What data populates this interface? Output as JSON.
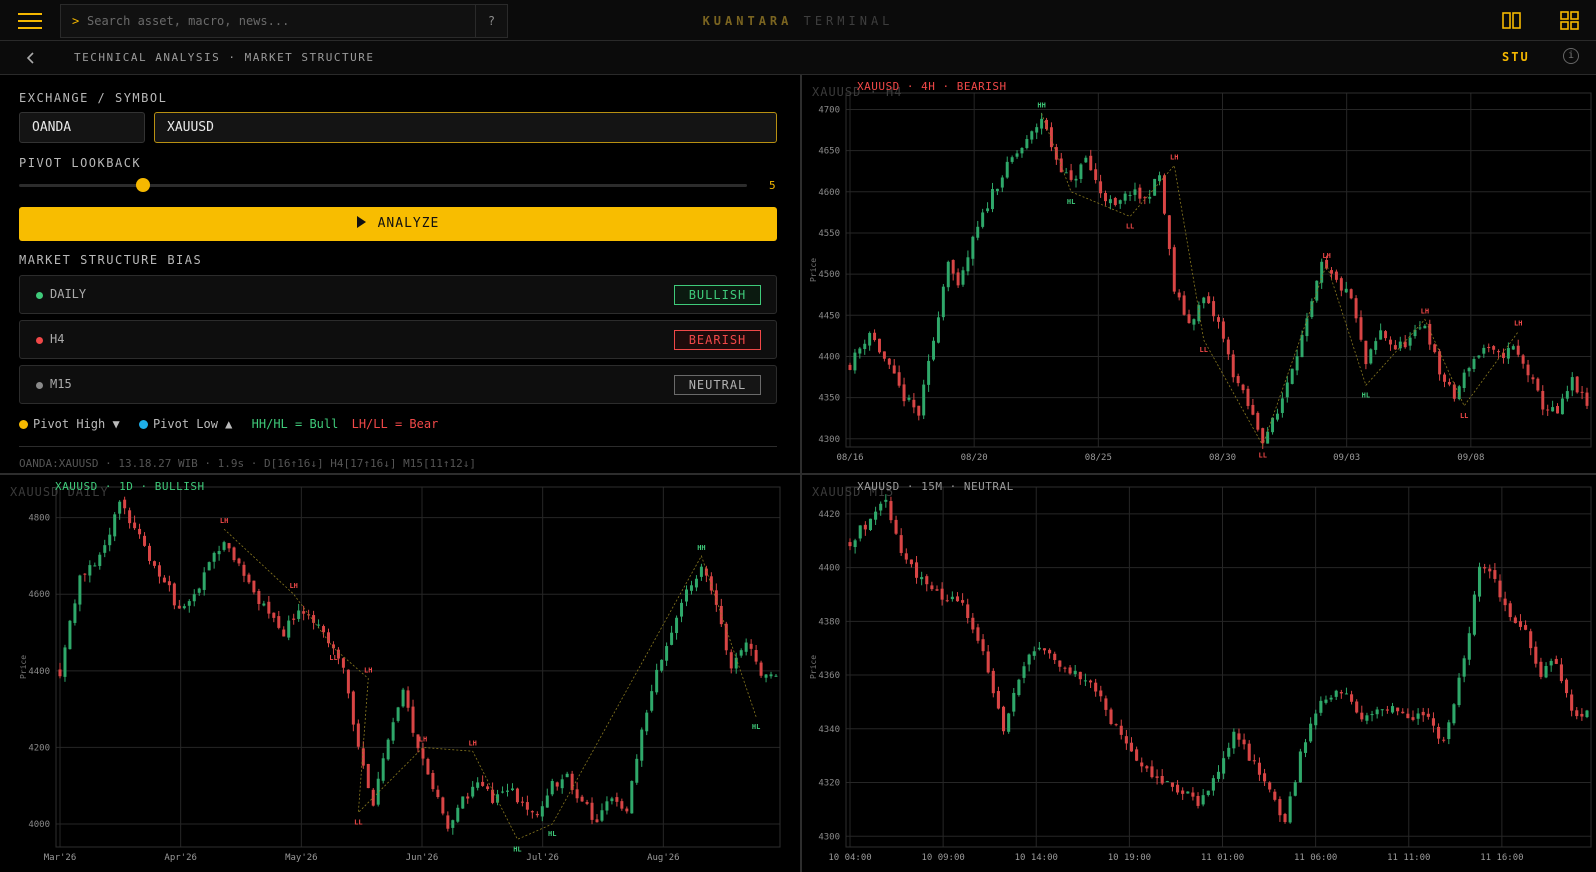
{
  "topbar": {
    "search_placeholder": "Search asset, macro, news...",
    "search_prompt": ">",
    "help_label": "?",
    "brand_primary": "KUANTARA",
    "brand_secondary": "TERMINAL"
  },
  "subbar": {
    "breadcrumb": "TECHNICAL ANALYSIS · MARKET STRUCTURE",
    "user": "STU",
    "info_label": "i"
  },
  "form": {
    "symbol_label": "EXCHANGE / SYMBOL",
    "exchange": "OANDA",
    "symbol": "XAUUSD",
    "pivot_label": "PIVOT LOOKBACK",
    "pivot_value": "5",
    "pivot_fraction": 0.17,
    "analyze_label": "ANALYZE"
  },
  "bias": {
    "title": "MARKET STRUCTURE BIAS",
    "rows": [
      {
        "name": "DAILY",
        "badge": "BULLISH",
        "color": "#3fca7a"
      },
      {
        "name": "H4",
        "badge": "BEARISH",
        "color": "#f04848"
      },
      {
        "name": "M15",
        "badge": "NEUTRAL",
        "color": "#8a8a8a"
      }
    ]
  },
  "legend": {
    "pivot_high": "Pivot High ▼",
    "pivot_low": "Pivot Low ▲",
    "bull": "HH/HL = Bull",
    "bear": "LH/LL = Bear",
    "high_color": "#f5b800",
    "low_color": "#1eaee8"
  },
  "status": "OANDA:XAUUSD · 13.18.27 WIB · 1.9s · D[16↑16↓] H4[17↑16↓] M15[11↑12↓]",
  "colors": {
    "accent": "#f5b800",
    "bull": "#3fca7a",
    "bear": "#f04848",
    "neutral": "#8a8a8a"
  },
  "charts": {
    "h4": {
      "watermark": "XAUUSD · H4",
      "title": "XAUUSD  ·  4H  ·  BEARISH",
      "bias_color": "#f04848",
      "ylabel": "Price",
      "x_ticks": [
        "08/16",
        "08/20",
        "08/25",
        "08/30",
        "09/03",
        "09/08"
      ],
      "y_ticks": [
        "4700",
        "4650",
        "4600",
        "4550",
        "4500",
        "4450",
        "4400",
        "4350",
        "4300"
      ]
    },
    "daily": {
      "watermark": "XAUUSD DAILY",
      "title": "XAUUSD  ·  1D  ·  BULLISH",
      "bias_color": "#3fca7a",
      "ylabel": "Price",
      "x_ticks": [
        "Mar'26",
        "Apr'26",
        "May'26",
        "Jun'26",
        "Jul'26",
        "Aug'26"
      ],
      "y_ticks": [
        "4800",
        "4600",
        "4400",
        "4200",
        "4000"
      ]
    },
    "m15": {
      "watermark": "XAUUSD M15",
      "title": "XAUUSD  ·  15M  ·  NEUTRAL",
      "bias_color": "#9a9a9a",
      "ylabel": "Price",
      "x_ticks": [
        "10 04:00",
        "10 09:00",
        "10 14:00",
        "10 19:00",
        "11 01:00",
        "11 06:00",
        "11 11:00",
        "11 16:00"
      ],
      "y_ticks": [
        "4420",
        "4400",
        "4380",
        "4360",
        "4340",
        "4320",
        "4300"
      ]
    }
  },
  "chart_data": [
    {
      "type": "candlestick",
      "title": "XAUUSD · 4H · BEARISH",
      "ylabel": "Price",
      "ylim": [
        4290,
        4720
      ],
      "x_ticks": [
        "08/16",
        "08/20",
        "08/25",
        "08/30",
        "09/03",
        "09/08"
      ],
      "close_path": [
        [
          0,
          4390
        ],
        [
          4,
          4430
        ],
        [
          8,
          4385
        ],
        [
          11,
          4350
        ],
        [
          14,
          4330
        ],
        [
          17,
          4420
        ],
        [
          20,
          4520
        ],
        [
          22,
          4480
        ],
        [
          25,
          4540
        ],
        [
          29,
          4600
        ],
        [
          33,
          4640
        ],
        [
          36,
          4660
        ],
        [
          39,
          4690
        ],
        [
          42,
          4640
        ],
        [
          45,
          4610
        ],
        [
          48,
          4640
        ],
        [
          51,
          4600
        ],
        [
          54,
          4580
        ],
        [
          57,
          4600
        ],
        [
          60,
          4590
        ],
        [
          63,
          4620
        ],
        [
          66,
          4480
        ],
        [
          69,
          4440
        ],
        [
          72,
          4470
        ],
        [
          75,
          4440
        ],
        [
          78,
          4380
        ],
        [
          81,
          4340
        ],
        [
          84,
          4300
        ],
        [
          87,
          4330
        ],
        [
          90,
          4390
        ],
        [
          93,
          4440
        ],
        [
          96,
          4510
        ],
        [
          99,
          4490
        ],
        [
          102,
          4470
        ],
        [
          105,
          4390
        ],
        [
          108,
          4430
        ],
        [
          111,
          4410
        ],
        [
          114,
          4420
        ],
        [
          117,
          4440
        ],
        [
          120,
          4380
        ],
        [
          123,
          4350
        ],
        [
          126,
          4390
        ],
        [
          129,
          4410
        ],
        [
          132,
          4400
        ],
        [
          135,
          4410
        ],
        [
          138,
          4380
        ],
        [
          141,
          4340
        ],
        [
          144,
          4330
        ],
        [
          147,
          4370
        ],
        [
          150,
          4340
        ]
      ],
      "pivots": [
        {
          "label": "HH",
          "i": 39,
          "price": 4695
        },
        {
          "label": "HL",
          "i": 45,
          "price": 4600
        },
        {
          "label": "LL",
          "i": 57,
          "price": 4570
        },
        {
          "label": "LH",
          "i": 66,
          "price": 4632
        },
        {
          "label": "LL",
          "i": 72,
          "price": 4420
        },
        {
          "label": "LL",
          "i": 84,
          "price": 4292
        },
        {
          "label": "LH",
          "i": 97,
          "price": 4512
        },
        {
          "label": "HL",
          "i": 105,
          "price": 4365
        },
        {
          "label": "LH",
          "i": 117,
          "price": 4445
        },
        {
          "label": "LL",
          "i": 125,
          "price": 4340
        },
        {
          "label": "LH",
          "i": 136,
          "price": 4430
        }
      ]
    },
    {
      "type": "candlestick",
      "title": "XAUUSD · 1D · BULLISH",
      "ylabel": "Price",
      "ylim": [
        3940,
        4880
      ],
      "x_ticks": [
        "Mar'26",
        "Apr'26",
        "May'26",
        "Jun'26",
        "Jul'26",
        "Aug'26"
      ],
      "close_path": [
        [
          0,
          4400
        ],
        [
          4,
          4650
        ],
        [
          8,
          4700
        ],
        [
          12,
          4830
        ],
        [
          15,
          4780
        ],
        [
          18,
          4700
        ],
        [
          21,
          4640
        ],
        [
          24,
          4550
        ],
        [
          27,
          4600
        ],
        [
          30,
          4680
        ],
        [
          33,
          4740
        ],
        [
          36,
          4680
        ],
        [
          39,
          4600
        ],
        [
          42,
          4550
        ],
        [
          45,
          4500
        ],
        [
          48,
          4560
        ],
        [
          51,
          4520
        ],
        [
          54,
          4480
        ],
        [
          57,
          4400
        ],
        [
          60,
          4200
        ],
        [
          63,
          4050
        ],
        [
          66,
          4230
        ],
        [
          69,
          4350
        ],
        [
          72,
          4200
        ],
        [
          75,
          4100
        ],
        [
          78,
          4000
        ],
        [
          81,
          4060
        ],
        [
          84,
          4120
        ],
        [
          87,
          4060
        ],
        [
          90,
          4100
        ],
        [
          93,
          4050
        ],
        [
          96,
          4010
        ],
        [
          99,
          4100
        ],
        [
          102,
          4120
        ],
        [
          105,
          4060
        ],
        [
          108,
          4000
        ],
        [
          111,
          4080
        ],
        [
          114,
          4040
        ],
        [
          117,
          4250
        ],
        [
          120,
          4400
        ],
        [
          123,
          4500
        ],
        [
          126,
          4600
        ],
        [
          129,
          4680
        ],
        [
          132,
          4560
        ],
        [
          135,
          4420
        ],
        [
          138,
          4480
        ],
        [
          141,
          4400
        ],
        [
          144,
          4380
        ]
      ],
      "pivots": [
        {
          "label": "LH",
          "i": 33,
          "price": 4770
        },
        {
          "label": "LH",
          "i": 47,
          "price": 4600
        },
        {
          "label": "LL",
          "i": 55,
          "price": 4460
        },
        {
          "label": "LH",
          "i": 62,
          "price": 4380
        },
        {
          "label": "LL",
          "i": 60,
          "price": 4030
        },
        {
          "label": "LH",
          "i": 73,
          "price": 4200
        },
        {
          "label": "LH",
          "i": 83,
          "price": 4190
        },
        {
          "label": "HL",
          "i": 92,
          "price": 3960
        },
        {
          "label": "HL",
          "i": 99,
          "price": 4000
        },
        {
          "label": "HH",
          "i": 129,
          "price": 4700
        },
        {
          "label": "HL",
          "i": 140,
          "price": 4280
        }
      ]
    },
    {
      "type": "candlestick",
      "title": "XAUUSD · 15M · NEUTRAL",
      "ylabel": "Price",
      "ylim": [
        4296,
        4430
      ],
      "x_ticks": [
        "10 04:00",
        "10 09:00",
        "10 14:00",
        "10 19:00",
        "11 01:00",
        "11 06:00",
        "11 11:00",
        "11 16:00"
      ],
      "close_path": [
        [
          0,
          4410
        ],
        [
          4,
          4418
        ],
        [
          7,
          4425
        ],
        [
          10,
          4405
        ],
        [
          14,
          4395
        ],
        [
          18,
          4390
        ],
        [
          22,
          4385
        ],
        [
          26,
          4370
        ],
        [
          30,
          4340
        ],
        [
          33,
          4360
        ],
        [
          36,
          4370
        ],
        [
          40,
          4365
        ],
        [
          44,
          4360
        ],
        [
          48,
          4355
        ],
        [
          52,
          4340
        ],
        [
          56,
          4328
        ],
        [
          60,
          4322
        ],
        [
          64,
          4318
        ],
        [
          68,
          4312
        ],
        [
          72,
          4325
        ],
        [
          75,
          4338
        ],
        [
          78,
          4330
        ],
        [
          82,
          4318
        ],
        [
          85,
          4305
        ],
        [
          88,
          4330
        ],
        [
          92,
          4350
        ],
        [
          96,
          4355
        ],
        [
          100,
          4345
        ],
        [
          104,
          4348
        ],
        [
          108,
          4345
        ],
        [
          112,
          4345
        ],
        [
          116,
          4335
        ],
        [
          120,
          4365
        ],
        [
          123,
          4400
        ],
        [
          126,
          4395
        ],
        [
          129,
          4380
        ],
        [
          132,
          4375
        ],
        [
          135,
          4360
        ],
        [
          138,
          4365
        ],
        [
          141,
          4345
        ],
        [
          144,
          4345
        ]
      ]
    }
  ]
}
